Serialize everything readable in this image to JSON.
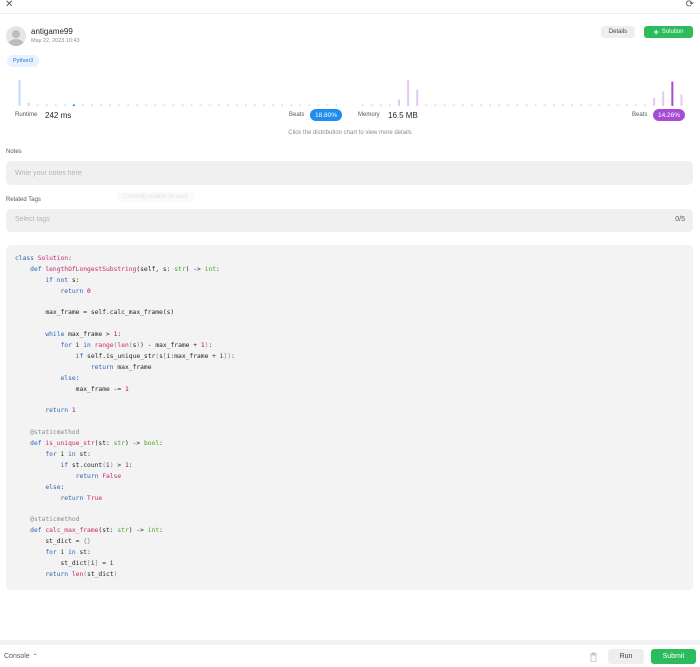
{
  "header": {
    "close_icon": "close-icon",
    "refresh_icon": "refresh-icon"
  },
  "submission": {
    "username": "antigame99",
    "timestamp": "May 22, 2023 10:43",
    "details_label": "Details",
    "solution_label": "Solution",
    "language": "Python3"
  },
  "runtime": {
    "label": "Runtime",
    "value": "242 ms",
    "beats_label": "Beats",
    "beats_percent": "18.80%",
    "color": "#1f8cf0",
    "distribution": [
      16,
      2,
      1,
      1,
      1,
      1,
      1,
      1,
      1,
      1,
      1,
      1,
      1,
      1,
      1,
      1,
      1,
      1,
      1,
      1,
      1,
      1,
      1,
      1,
      1,
      1,
      1,
      1,
      1,
      1,
      1,
      1,
      1,
      1,
      1,
      1
    ],
    "highlight_index": 6
  },
  "memory": {
    "label": "Memory",
    "value": "16.5 MB",
    "beats_label": "Beats",
    "beats_percent": "14.26%",
    "color": "#a64bd6",
    "distribution": [
      1,
      1,
      1,
      1,
      4,
      16,
      10,
      1,
      1,
      1,
      1,
      1,
      1,
      1,
      1,
      1,
      1,
      1,
      1,
      1,
      1,
      1,
      1,
      1,
      1,
      1,
      1,
      1,
      1,
      1,
      1,
      1,
      5,
      9,
      15,
      7
    ],
    "highlight_index": 34
  },
  "chart_hint": "Click the distribution chart to view more details",
  "notes": {
    "label": "Notes",
    "placeholder": "Write your notes here",
    "value": ""
  },
  "ghost_tooltip": "Currently unable to save",
  "tags": {
    "label": "Related Tags",
    "placeholder": "Select tags",
    "count": "0/5"
  },
  "code": [
    [
      [
        "kw",
        "class "
      ],
      [
        "cls",
        "Solution"
      ],
      [
        "",
        ":"
      ]
    ],
    [
      [
        "",
        "    "
      ],
      [
        "kw",
        "def "
      ],
      [
        "fn",
        "lengthOfLongestSubstring"
      ],
      [
        "",
        "(self, s: "
      ],
      [
        "tp",
        "str"
      ],
      [
        "",
        ") -> "
      ],
      [
        "tp",
        "int"
      ],
      [
        "",
        ":"
      ]
    ],
    [
      [
        "",
        "        "
      ],
      [
        "kw",
        "if not "
      ],
      [
        "",
        "s:"
      ]
    ],
    [
      [
        "",
        "            "
      ],
      [
        "kw",
        "return "
      ],
      [
        "num",
        "0"
      ]
    ],
    [
      [
        "",
        ""
      ]
    ],
    [
      [
        "",
        "        max_frame = self.calc_max_frame(s)"
      ]
    ],
    [
      [
        "",
        ""
      ]
    ],
    [
      [
        "",
        "        "
      ],
      [
        "kw",
        "while "
      ],
      [
        "",
        "max_frame > "
      ],
      [
        "num",
        "1"
      ],
      [
        "",
        ":"
      ]
    ],
    [
      [
        "",
        "            "
      ],
      [
        "kw",
        "for "
      ],
      [
        "",
        "i "
      ],
      [
        "kw",
        "in "
      ],
      [
        "bi",
        "range"
      ],
      [
        "bk",
        "("
      ],
      [
        "bi",
        "len"
      ],
      [
        "bk",
        "("
      ],
      [
        "",
        "s"
      ],
      [
        "bk",
        ")"
      ],
      [
        "",
        ") - max_frame + "
      ],
      [
        "num",
        "1"
      ],
      [
        "bk",
        ")"
      ],
      [
        "",
        ":"
      ]
    ],
    [
      [
        "",
        "                "
      ],
      [
        "kw",
        "if "
      ],
      [
        "",
        "self.is_unique_str"
      ],
      [
        "bk",
        "("
      ],
      [
        "",
        "s"
      ],
      [
        "bk",
        "["
      ],
      [
        "",
        "i:max_frame + i"
      ],
      [
        "bk",
        "])"
      ],
      [
        "",
        ":"
      ]
    ],
    [
      [
        "",
        "                    "
      ],
      [
        "kw",
        "return "
      ],
      [
        "",
        "max_frame"
      ]
    ],
    [
      [
        "",
        "            "
      ],
      [
        "kw",
        "else"
      ],
      [
        "",
        ":"
      ]
    ],
    [
      [
        "",
        "                max_frame -= "
      ],
      [
        "num",
        "1"
      ]
    ],
    [
      [
        "",
        ""
      ]
    ],
    [
      [
        "",
        "        "
      ],
      [
        "kw",
        "return "
      ],
      [
        "num",
        "1"
      ]
    ],
    [
      [
        "",
        ""
      ]
    ],
    [
      [
        "",
        "    "
      ],
      [
        "dec",
        "@staticmethod"
      ]
    ],
    [
      [
        "",
        "    "
      ],
      [
        "kw",
        "def "
      ],
      [
        "fn",
        "is_unique_str"
      ],
      [
        "",
        "(st: "
      ],
      [
        "tp",
        "str"
      ],
      [
        "",
        ") -> "
      ],
      [
        "tp",
        "bool"
      ],
      [
        "",
        ":"
      ]
    ],
    [
      [
        "",
        "        "
      ],
      [
        "kw",
        "for "
      ],
      [
        "",
        "i "
      ],
      [
        "kw",
        "in "
      ],
      [
        "",
        "st:"
      ]
    ],
    [
      [
        "",
        "            "
      ],
      [
        "kw",
        "if "
      ],
      [
        "",
        "st.count"
      ],
      [
        "bk",
        "("
      ],
      [
        "",
        "i"
      ],
      [
        "bk",
        ")"
      ],
      [
        "",
        " > "
      ],
      [
        "num",
        "1"
      ],
      [
        "",
        ":"
      ]
    ],
    [
      [
        "",
        "                "
      ],
      [
        "kw",
        "return "
      ],
      [
        "cls",
        "False"
      ]
    ],
    [
      [
        "",
        "        "
      ],
      [
        "kw",
        "else"
      ],
      [
        "",
        ":"
      ]
    ],
    [
      [
        "",
        "            "
      ],
      [
        "kw",
        "return "
      ],
      [
        "cls",
        "True"
      ]
    ],
    [
      [
        "",
        ""
      ]
    ],
    [
      [
        "",
        "    "
      ],
      [
        "dec",
        "@staticmethod"
      ]
    ],
    [
      [
        "",
        "    "
      ],
      [
        "kw",
        "def "
      ],
      [
        "fn",
        "calc_max_frame"
      ],
      [
        "",
        "(st: "
      ],
      [
        "tp",
        "str"
      ],
      [
        "",
        ") -> "
      ],
      [
        "tp",
        "int"
      ],
      [
        "",
        ":"
      ]
    ],
    [
      [
        "",
        "        st_dict = "
      ],
      [
        "bk",
        "{}"
      ]
    ],
    [
      [
        "",
        "        "
      ],
      [
        "kw",
        "for "
      ],
      [
        "",
        "i "
      ],
      [
        "kw",
        "in "
      ],
      [
        "",
        "st:"
      ]
    ],
    [
      [
        "",
        "            st_dict"
      ],
      [
        "bk",
        "["
      ],
      [
        "",
        "i"
      ],
      [
        "bk",
        "]"
      ],
      [
        "",
        ""
      ],
      [
        "",
        ""
      ],
      [
        "",
        ""
      ],
      [
        "",
        ""
      ],
      [
        "",
        ""
      ],
      [
        "",
        ""
      ],
      [
        "",
        ""
      ],
      [
        "",
        ""
      ],
      [
        "",
        " = i"
      ]
    ],
    [
      [
        "",
        "        "
      ],
      [
        "kw",
        "return "
      ],
      [
        "bi",
        "len"
      ],
      [
        "bk",
        "("
      ],
      [
        "",
        "st_dict"
      ],
      [
        "bk",
        ")"
      ]
    ]
  ],
  "footer": {
    "console_label": "Console",
    "run_label": "Run",
    "submit_label": "Submit"
  }
}
